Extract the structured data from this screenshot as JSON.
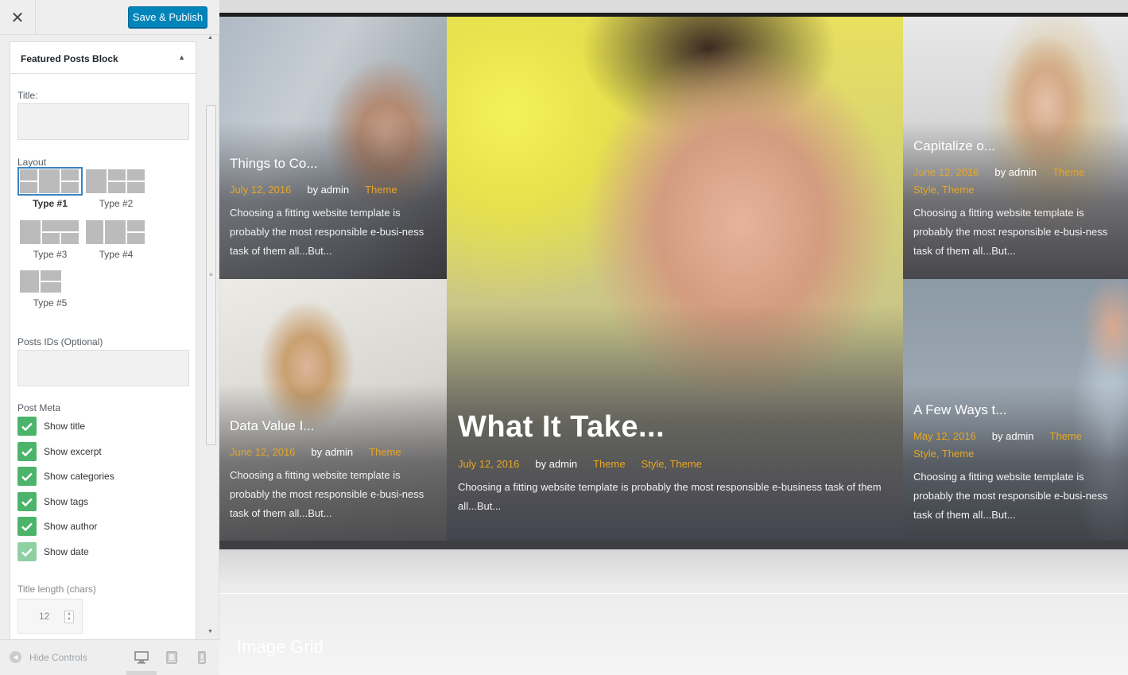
{
  "toolbar": {
    "close_glyph": "✕",
    "publish_label": "Save & Publish"
  },
  "panel": {
    "title": "Featured Posts Block",
    "title_label": "Title:",
    "title_value": "",
    "layout_label": "Layout",
    "layouts": [
      {
        "label": "Type #1",
        "selected": true
      },
      {
        "label": "Type #2",
        "selected": false
      },
      {
        "label": "Type #3",
        "selected": false
      },
      {
        "label": "Type #4",
        "selected": false
      },
      {
        "label": "Type #5",
        "selected": false
      }
    ],
    "posts_ids_label": "Posts IDs (Optional)",
    "posts_ids_value": "",
    "post_meta_label": "Post Meta",
    "post_meta": [
      {
        "label": "Show title",
        "checked": true
      },
      {
        "label": "Show excerpt",
        "checked": true
      },
      {
        "label": "Show categories",
        "checked": true
      },
      {
        "label": "Show tags",
        "checked": true
      },
      {
        "label": "Show author",
        "checked": true
      },
      {
        "label": "Show date",
        "checked": true
      }
    ],
    "title_length_label": "Title length (chars)",
    "title_length_value": "12"
  },
  "footer": {
    "hide_controls": "Hide Controls",
    "devices": [
      "desktop-icon",
      "tablet-icon",
      "mobile-icon"
    ]
  },
  "posts": [
    {
      "title": "Things to Co...",
      "date": "July 12, 2016",
      "author": "by admin",
      "categories": "Theme",
      "tags": "",
      "excerpt": "Choosing a fitting website template is probably the most responsible e-busi-ness task of them all...But..."
    },
    {
      "title": "Data Value I...",
      "date": "June 12, 2016",
      "author": "by admin",
      "categories": "Theme",
      "tags": "",
      "excerpt": "Choosing a fitting website template is probably the most responsible e-busi-ness task of them all...But..."
    },
    {
      "title": "What It Take...",
      "date": "July 12, 2016",
      "author": "by admin",
      "categories": "Theme",
      "tags": "Style, Theme",
      "excerpt": "Choosing a fitting website template is probably the most responsible e-business task of them all...But..."
    },
    {
      "title": "Capitalize o...",
      "date": "June 12, 2016",
      "author": "by admin",
      "categories": "Theme",
      "tags": "Style, Theme",
      "excerpt": "Choosing a fitting website template is probably the most responsible e-busi-ness task of them all...But..."
    },
    {
      "title": "A Few Ways t...",
      "date": "May 12, 2016",
      "author": "by admin",
      "categories": "Theme",
      "tags": "Style, Theme",
      "excerpt": "Choosing a fitting website template is probably the most responsible e-busi-ness task of them all...But..."
    }
  ],
  "section_title": "Image Grid",
  "colors": {
    "accent": "#0085ba",
    "check": "#4cb36b",
    "meta_highlight": "#e8a623",
    "selected_outline": "#3a83c2"
  }
}
